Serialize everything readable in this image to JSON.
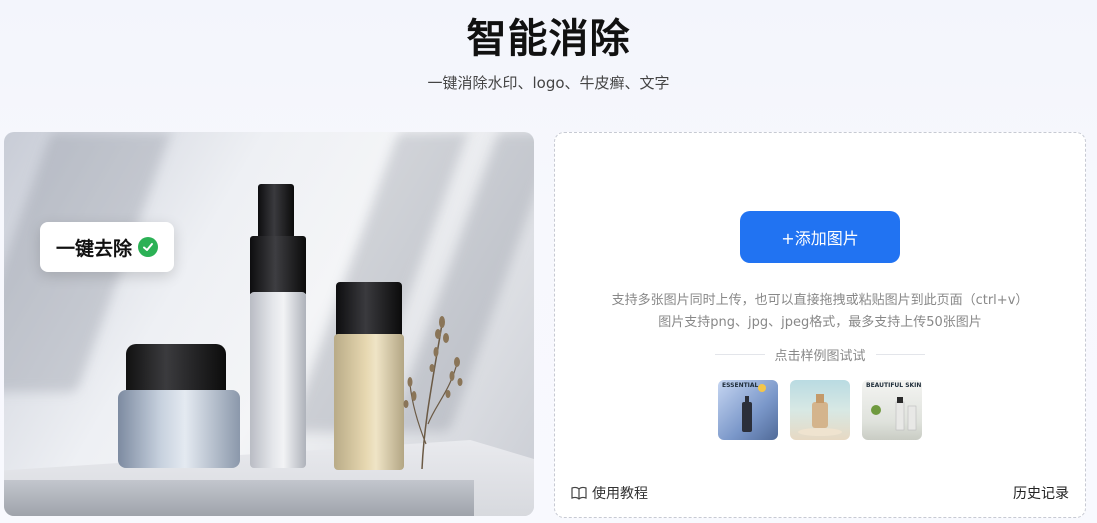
{
  "header": {
    "title": "智能消除",
    "subtitle": "一键消除水印、logo、牛皮癣、文字"
  },
  "preview": {
    "badge_label": "一键去除"
  },
  "upload": {
    "add_button_label": "+添加图片",
    "hint_line1": "支持多张图片同时上传，也可以直接拖拽或粘贴图片到此页面（ctrl+v）",
    "hint_line2": "图片支持png、jpg、jpeg格式，最多支持上传50张图片",
    "sample_label": "点击样例图试试",
    "thumbs": [
      {
        "text": "ESSENTIAL"
      },
      {
        "text": ""
      },
      {
        "text": "BEAUTIFUL SKIN"
      }
    ],
    "tutorial_label": "使用教程",
    "history_label": "历史记录"
  },
  "colors": {
    "accent": "#2173f2",
    "check": "#2bb155"
  }
}
